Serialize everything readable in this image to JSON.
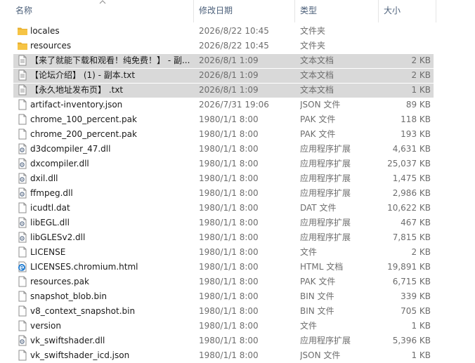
{
  "columns": {
    "name": "名称",
    "date": "修改日期",
    "type": "类型",
    "size": "大小"
  },
  "files": [
    {
      "name": "locales",
      "date": "2026/8/22 10:45",
      "type": "文件夹",
      "size": "",
      "icon": "folder-icon",
      "selected": false
    },
    {
      "name": "resources",
      "date": "2026/8/22 10:45",
      "type": "文件夹",
      "size": "",
      "icon": "folder-icon",
      "selected": false
    },
    {
      "name": "【来了就能下载和观看！纯免费！】 - 副...",
      "date": "2026/8/1 1:09",
      "type": "文本文档",
      "size": "2 KB",
      "icon": "text-file-icon",
      "selected": true
    },
    {
      "name": "【论坛介绍】 (1) - 副本.txt",
      "date": "2026/8/1 1:09",
      "type": "文本文档",
      "size": "2 KB",
      "icon": "text-file-icon",
      "selected": true
    },
    {
      "name": "【永久地址发布页】 .txt",
      "date": "2026/8/1 1:09",
      "type": "文本文档",
      "size": "1 KB",
      "icon": "text-file-icon",
      "selected": true
    },
    {
      "name": "artifact-inventory.json",
      "date": "2026/7/31 19:06",
      "type": "JSON 文件",
      "size": "89 KB",
      "icon": "file-icon",
      "selected": false
    },
    {
      "name": "chrome_100_percent.pak",
      "date": "1980/1/1 8:00",
      "type": "PAK 文件",
      "size": "118 KB",
      "icon": "file-icon",
      "selected": false
    },
    {
      "name": "chrome_200_percent.pak",
      "date": "1980/1/1 8:00",
      "type": "PAK 文件",
      "size": "193 KB",
      "icon": "file-icon",
      "selected": false
    },
    {
      "name": "d3dcompiler_47.dll",
      "date": "1980/1/1 8:00",
      "type": "应用程序扩展",
      "size": "4,631 KB",
      "icon": "dll-file-icon",
      "selected": false
    },
    {
      "name": "dxcompiler.dll",
      "date": "1980/1/1 8:00",
      "type": "应用程序扩展",
      "size": "25,037 KB",
      "icon": "dll-file-icon",
      "selected": false
    },
    {
      "name": "dxil.dll",
      "date": "1980/1/1 8:00",
      "type": "应用程序扩展",
      "size": "1,475 KB",
      "icon": "dll-file-icon",
      "selected": false
    },
    {
      "name": "ffmpeg.dll",
      "date": "1980/1/1 8:00",
      "type": "应用程序扩展",
      "size": "2,986 KB",
      "icon": "dll-file-icon",
      "selected": false
    },
    {
      "name": "icudtl.dat",
      "date": "1980/1/1 8:00",
      "type": "DAT 文件",
      "size": "10,622 KB",
      "icon": "file-icon",
      "selected": false
    },
    {
      "name": "libEGL.dll",
      "date": "1980/1/1 8:00",
      "type": "应用程序扩展",
      "size": "467 KB",
      "icon": "dll-file-icon",
      "selected": false
    },
    {
      "name": "libGLESv2.dll",
      "date": "1980/1/1 8:00",
      "type": "应用程序扩展",
      "size": "7,815 KB",
      "icon": "dll-file-icon",
      "selected": false
    },
    {
      "name": "LICENSE",
      "date": "1980/1/1 8:00",
      "type": "文件",
      "size": "2 KB",
      "icon": "file-icon",
      "selected": false
    },
    {
      "name": "LICENSES.chromium.html",
      "date": "1980/1/1 8:00",
      "type": "HTML 文档",
      "size": "19,891 KB",
      "icon": "edge-html-icon",
      "selected": false
    },
    {
      "name": "resources.pak",
      "date": "1980/1/1 8:00",
      "type": "PAK 文件",
      "size": "6,715 KB",
      "icon": "file-icon",
      "selected": false
    },
    {
      "name": "snapshot_blob.bin",
      "date": "1980/1/1 8:00",
      "type": "BIN 文件",
      "size": "339 KB",
      "icon": "file-icon",
      "selected": false
    },
    {
      "name": "v8_context_snapshot.bin",
      "date": "1980/1/1 8:00",
      "type": "BIN 文件",
      "size": "705 KB",
      "icon": "file-icon",
      "selected": false
    },
    {
      "name": "version",
      "date": "1980/1/1 8:00",
      "type": "文件",
      "size": "1 KB",
      "icon": "file-icon",
      "selected": false
    },
    {
      "name": "vk_swiftshader.dll",
      "date": "1980/1/1 8:00",
      "type": "应用程序扩展",
      "size": "5,396 KB",
      "icon": "dll-file-icon",
      "selected": false
    },
    {
      "name": "vk_swiftshader_icd.json",
      "date": "1980/1/1 8:00",
      "type": "JSON 文件",
      "size": "1 KB",
      "icon": "file-icon",
      "selected": false
    }
  ],
  "colors": {
    "header_text": "#4c607a",
    "selection": "#d9d9d9",
    "folder": "#f6c445",
    "edge_blue": "#1f7bd1"
  }
}
